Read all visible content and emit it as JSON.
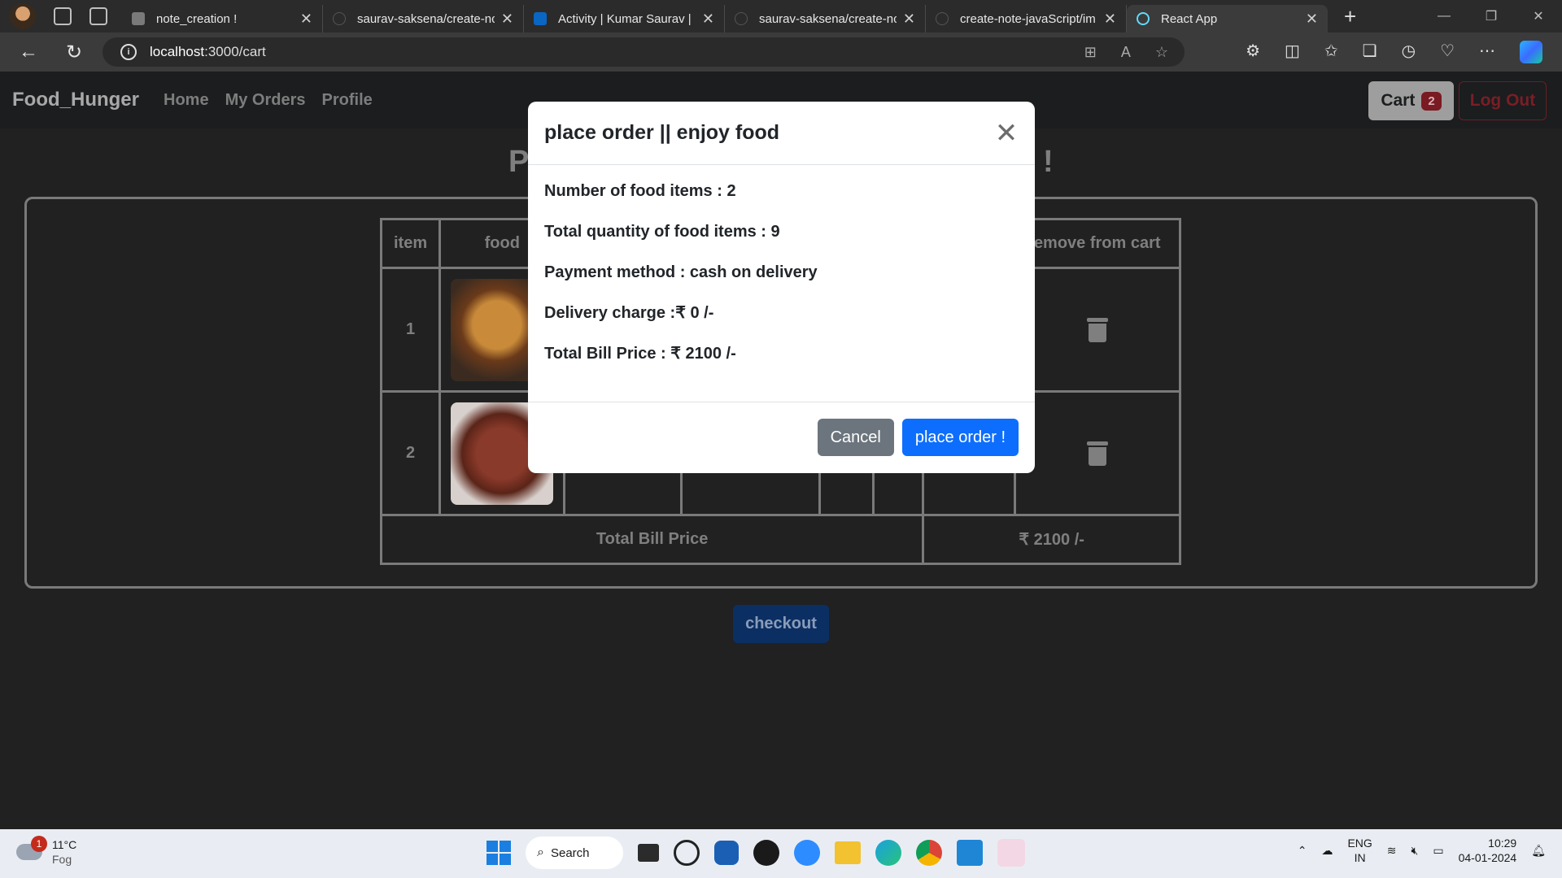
{
  "browser": {
    "tabs": [
      {
        "title": "note_creation !",
        "favicon_color": "#7a7a7a"
      },
      {
        "title": "saurav-saksena/create-nc",
        "favicon_color": "#2b2b2b"
      },
      {
        "title": "Activity | Kumar Saurav | L",
        "favicon_color": "#0a66c2"
      },
      {
        "title": "saurav-saksena/create-nc",
        "favicon_color": "#2b2b2b"
      },
      {
        "title": "create-note-javaScript/im",
        "favicon_color": "#2b2b2b"
      },
      {
        "title": "React App",
        "favicon_color": "#61dafb"
      }
    ],
    "url_host": "localhost",
    "url_rest": ":3000/cart"
  },
  "navbar": {
    "brand": "Food_Hunger",
    "links": [
      "Home",
      "My Orders",
      "Profile"
    ],
    "cart_label": "Cart",
    "cart_count": "2",
    "logout_label": "Log Out"
  },
  "page": {
    "heading_left": "P",
    "heading_right": "!",
    "table_headers": [
      "item",
      "food",
      "",
      "",
      "",
      "",
      "",
      "emove from cart"
    ],
    "rows": [
      {
        "item": "1"
      },
      {
        "item": "2"
      }
    ],
    "total_label": "Total Bill Price",
    "total_value": "₹ 2100 /-",
    "checkout_label": "checkout"
  },
  "modal": {
    "title": "place order || enjoy food",
    "lines": [
      "Number of food items : 2",
      "Total quantity of food items : 9",
      "Payment method : cash on delivery",
      "Delivery charge :₹ 0 /-",
      "Total Bill Price : ₹ 2100 /-"
    ],
    "cancel_label": "Cancel",
    "place_label": "place order !"
  },
  "taskbar": {
    "weather_badge": "1",
    "temperature": "11°C",
    "condition": "Fog",
    "search_label": "Search",
    "lang_line1": "ENG",
    "lang_line2": "IN",
    "time": "10:29",
    "date": "04-01-2024"
  }
}
